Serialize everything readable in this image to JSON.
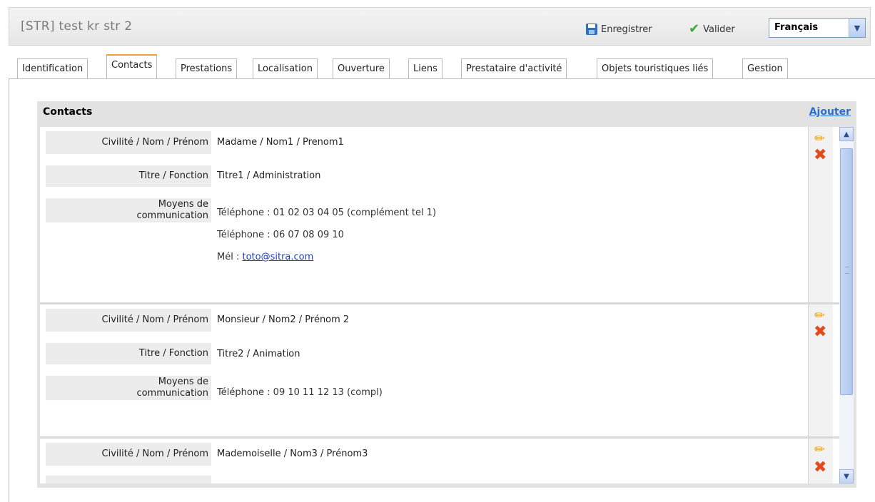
{
  "header": {
    "title": "[STR]  test kr str 2",
    "save_label": "Enregistrer",
    "validate_label": "Valider",
    "language": "Français"
  },
  "tabs": [
    {
      "label": "Identification"
    },
    {
      "label": "Contacts"
    },
    {
      "label": "Prestations"
    },
    {
      "label": "Localisation"
    },
    {
      "label": "Ouverture"
    },
    {
      "label": "Liens"
    },
    {
      "label": "Prestataire d'activité"
    },
    {
      "label": "Objets touristiques liés"
    },
    {
      "label": "Gestion"
    }
  ],
  "active_tab": "Contacts",
  "panel": {
    "title": "Contacts",
    "add_label": "Ajouter"
  },
  "labels": {
    "name": "Civilité / Nom / Prénom",
    "title": "Titre / Fonction",
    "comm_line1": "Moyens de",
    "comm_line2": "communication"
  },
  "contacts": [
    {
      "name": "Madame / Nom1 / Prenom1",
      "title": "Titre1 / Administration",
      "comms": [
        "Téléphone : 01 02 03 04 05 (complément tel 1)",
        "Téléphone : 06 07 08 09 10"
      ],
      "mail_prefix": "Mél : ",
      "mail": "toto@sitra.com"
    },
    {
      "name": "Monsieur / Nom2 / Prénom 2",
      "title": "Titre2 / Animation",
      "comms": [
        "Téléphone : 09 10 11 12 13 (compl)"
      ]
    },
    {
      "name": "Mademoiselle / Nom3 / Prénom3"
    }
  ],
  "colors": {
    "accent_tab": "#f0a030",
    "link": "#2a6fd0",
    "delete": "#e24a1c",
    "edit": "#e0a21a"
  }
}
